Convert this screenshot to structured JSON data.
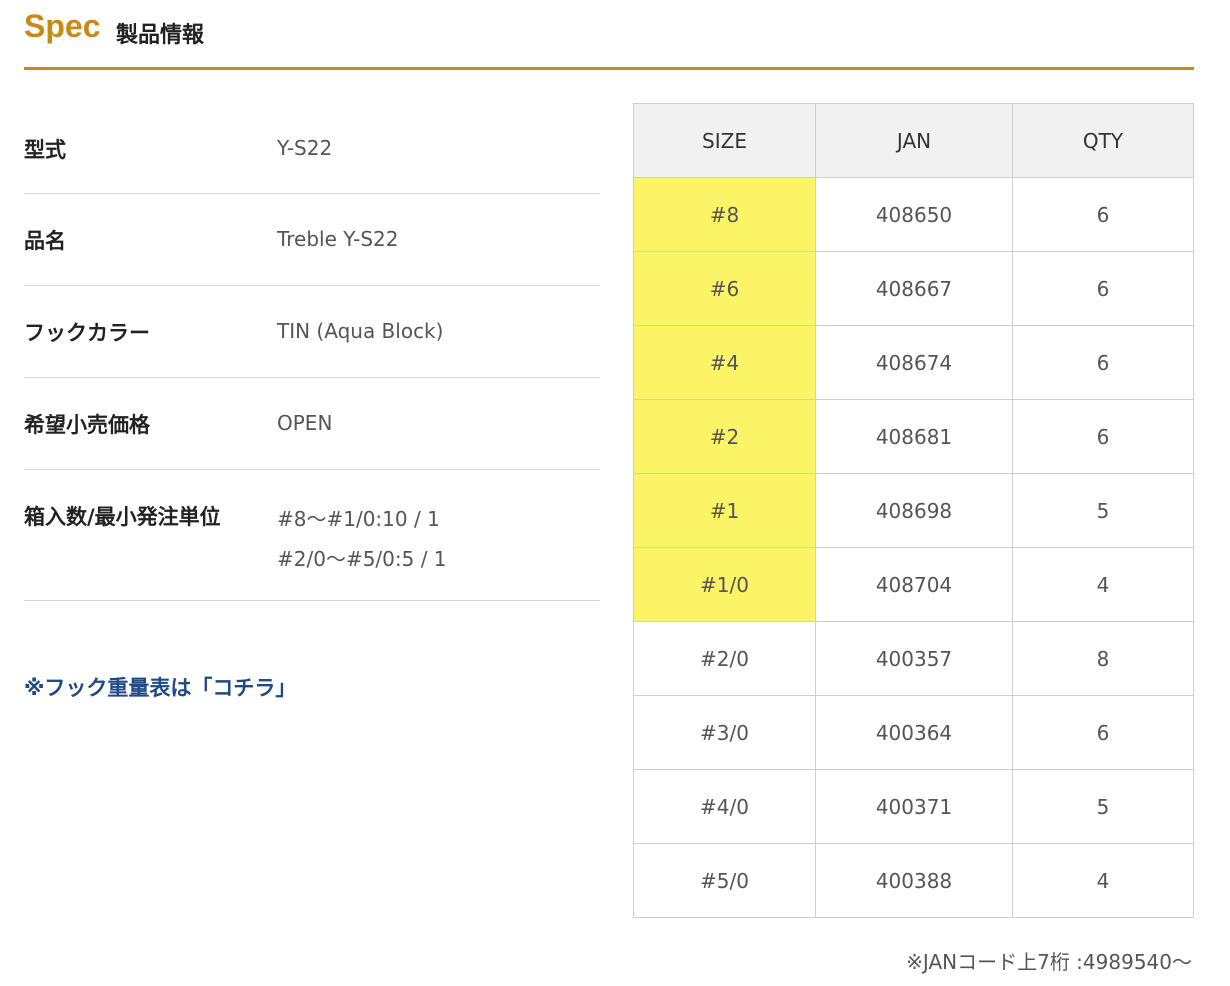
{
  "heading": {
    "title": "Spec",
    "subtitle": "製品情報"
  },
  "specs": [
    {
      "label": "型式",
      "value": "Y-S22"
    },
    {
      "label": "品名",
      "value": "Treble Y-S22"
    },
    {
      "label": "フックカラー",
      "value": "TIN (Aqua Block)"
    },
    {
      "label": "希望小売価格",
      "value": "OPEN"
    },
    {
      "label": "箱入数/最小発注単位",
      "value": "#8〜#1/0:10 / 1",
      "value2": "#2/0〜#5/0:5 / 1"
    }
  ],
  "weight_link": "※フック重量表は「コチラ」",
  "jan_table": {
    "headers": [
      "SIZE",
      "JAN",
      "QTY"
    ],
    "highlight_color": "#fbf466",
    "rows": [
      {
        "size": "#8",
        "jan": "408650",
        "qty": "6",
        "highlight": true
      },
      {
        "size": "#6",
        "jan": "408667",
        "qty": "6",
        "highlight": true
      },
      {
        "size": "#4",
        "jan": "408674",
        "qty": "6",
        "highlight": true
      },
      {
        "size": "#2",
        "jan": "408681",
        "qty": "6",
        "highlight": true
      },
      {
        "size": "#1",
        "jan": "408698",
        "qty": "5",
        "highlight": true
      },
      {
        "size": "#1/0",
        "jan": "408704",
        "qty": "4",
        "highlight": true
      },
      {
        "size": "#2/0",
        "jan": "400357",
        "qty": "8",
        "highlight": false
      },
      {
        "size": "#3/0",
        "jan": "400364",
        "qty": "6",
        "highlight": false
      },
      {
        "size": "#4/0",
        "jan": "400371",
        "qty": "5",
        "highlight": false
      },
      {
        "size": "#5/0",
        "jan": "400388",
        "qty": "4",
        "highlight": false
      }
    ]
  },
  "jan_note": "※JANコード上7桁 :4989540〜"
}
